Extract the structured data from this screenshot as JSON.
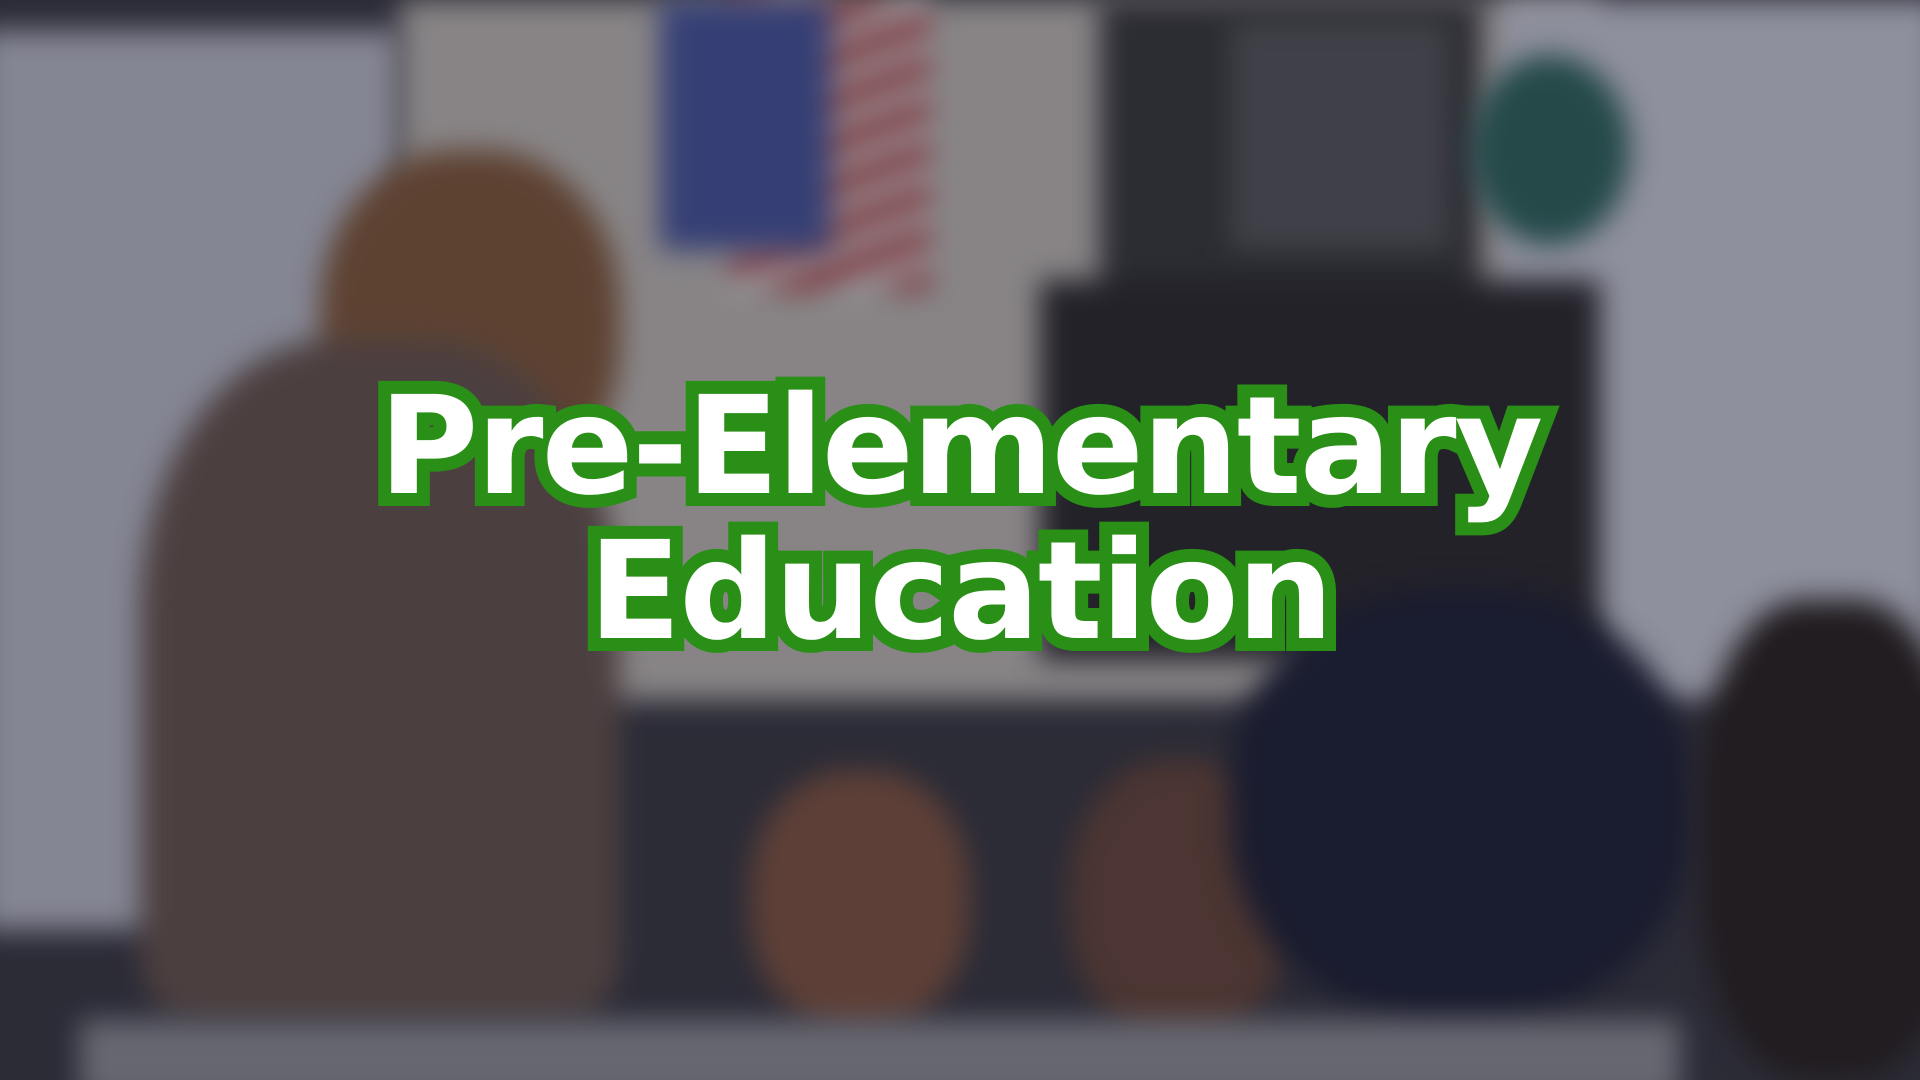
{
  "title": {
    "line1": "Pre-Elementary",
    "line2": "Education"
  },
  "colors": {
    "text": "#ffffff",
    "outline": "#2a8f17"
  },
  "background": "blurred-classroom-photo"
}
